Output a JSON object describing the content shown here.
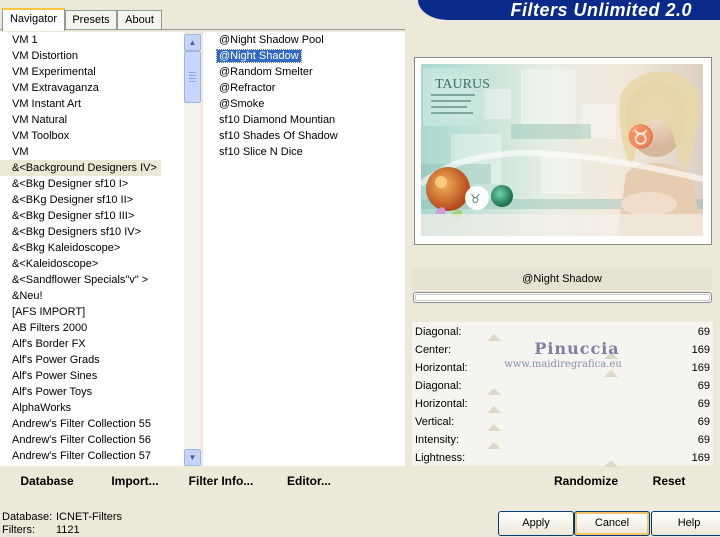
{
  "tabs": [
    {
      "label": "Navigator",
      "active": true
    },
    {
      "label": "Presets",
      "active": false
    },
    {
      "label": "About",
      "active": false
    }
  ],
  "banner": {
    "title": "Filters Unlimited 2.0",
    "color": "#0a2a8c"
  },
  "categories": {
    "items": [
      "VM 1",
      "VM Distortion",
      "VM Experimental",
      "VM Extravaganza",
      "VM Instant Art",
      "VM Natural",
      "VM Toolbox",
      "VM",
      "&<Background Designers IV>",
      "&<Bkg Designer sf10 I>",
      "&<BKg Designer sf10 II>",
      "&<Bkg Designer sf10 III>",
      "&<Bkg Designers sf10 IV>",
      "&<Bkg Kaleidoscope>",
      "&<Kaleidoscope>",
      "&<Sandflower Specials\"v\" >",
      "&Neu!",
      "[AFS IMPORT]",
      "AB Filters 2000",
      "Alf's Border FX",
      "Alf's Power Grads",
      "Alf's Power Sines",
      "Alf's Power Toys",
      "AlphaWorks",
      "Andrew's Filter Collection 55",
      "Andrew's Filter Collection 56",
      "Andrew's Filter Collection 57"
    ],
    "selected": "&<Background Designers IV>"
  },
  "filters": {
    "items": [
      "@Night Shadow Pool",
      "@Night Shadow",
      "@Random Smelter",
      "@Refractor",
      "@Smoke",
      "sf10 Diamond Mountian",
      "sf10 Shades Of Shadow",
      "sf10 Slice N Dice"
    ],
    "selected": "@Night Shadow"
  },
  "bottom_bar": {
    "database": "Database",
    "import": "Import...",
    "filter_info": "Filter Info...",
    "editor": "Editor...",
    "randomize": "Randomize",
    "reset": "Reset"
  },
  "preview": {
    "logo_text": "TAURUS",
    "caption": "Taurus"
  },
  "current_filter": "@Night Shadow",
  "controls": [
    {
      "label": "Diagonal:",
      "value": "69"
    },
    {
      "label": "Center:",
      "value": "169"
    },
    {
      "label": "Horizontal:",
      "value": "169"
    },
    {
      "label": "Diagonal:",
      "value": "69"
    },
    {
      "label": "Horizontal:",
      "value": "69"
    },
    {
      "label": "Vertical:",
      "value": "69"
    },
    {
      "label": "Intensity:",
      "value": "69"
    },
    {
      "label": "Lightness:",
      "value": "169"
    }
  ],
  "watermark": {
    "name": "Pinuccia",
    "site": "www.maidiregrafica.eu"
  },
  "footer": {
    "database_label": "Database:",
    "database_value": "ICNET-Filters",
    "filters_label": "Filters:",
    "filters_value": "1121"
  },
  "buttons": {
    "apply": "Apply",
    "cancel": "Cancel",
    "help": "Help"
  }
}
